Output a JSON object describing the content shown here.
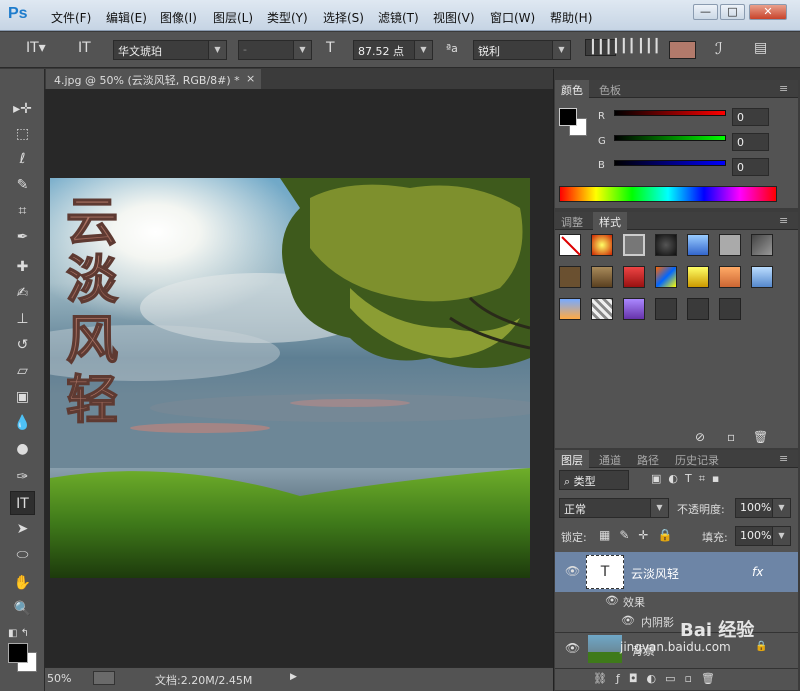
{
  "app": {
    "logo": "Ps",
    "title_menus": [
      "文件(F)",
      "编辑(E)",
      "图像(I)",
      "图层(L)",
      "类型(Y)",
      "选择(S)",
      "滤镜(T)",
      "视图(V)",
      "窗口(W)",
      "帮助(H)"
    ],
    "window_buttons": {
      "minimize": "—",
      "maximize": "□",
      "close": "✕"
    }
  },
  "options": {
    "orientation_icon": "ⅠT",
    "font_family": "华文琥珀",
    "font_style": "-",
    "size_icon": "T",
    "font_size": "87.52 点",
    "aa_icon": "ªa",
    "antialias": "锐利",
    "text_color": "#b27a6b"
  },
  "document": {
    "tab_title": "4.jpg @ 50% (云淡风轻, RGB/8#) *",
    "close": "×",
    "artwork_text": [
      "云",
      "淡",
      "风",
      "轻"
    ]
  },
  "status": {
    "zoom": "50%",
    "doc_info": "文档:2.20M/2.45M"
  },
  "color_panel": {
    "tabs": [
      "颜色",
      "色板"
    ],
    "channels": [
      {
        "label": "R",
        "value": "0"
      },
      {
        "label": "G",
        "value": "0"
      },
      {
        "label": "B",
        "value": "0"
      }
    ]
  },
  "styles_panel": {
    "tabs": [
      "调整",
      "样式"
    ]
  },
  "layers_panel": {
    "tabs": [
      "图层",
      "通道",
      "路径",
      "历史记录"
    ],
    "filter_kind": "类型",
    "blend_mode": "正常",
    "opacity_label": "不透明度:",
    "opacity": "100%",
    "lock_label": "锁定:",
    "fill_label": "填充:",
    "fill": "100%",
    "layers": [
      {
        "name": "云淡风轻",
        "fx": "fx",
        "thumb": "T"
      },
      {
        "name": "效果"
      },
      {
        "name": "内阴影"
      },
      {
        "name": "背景"
      }
    ]
  },
  "watermark": {
    "text": "Bai 经验",
    "url": "jingyan.baidu.com"
  }
}
